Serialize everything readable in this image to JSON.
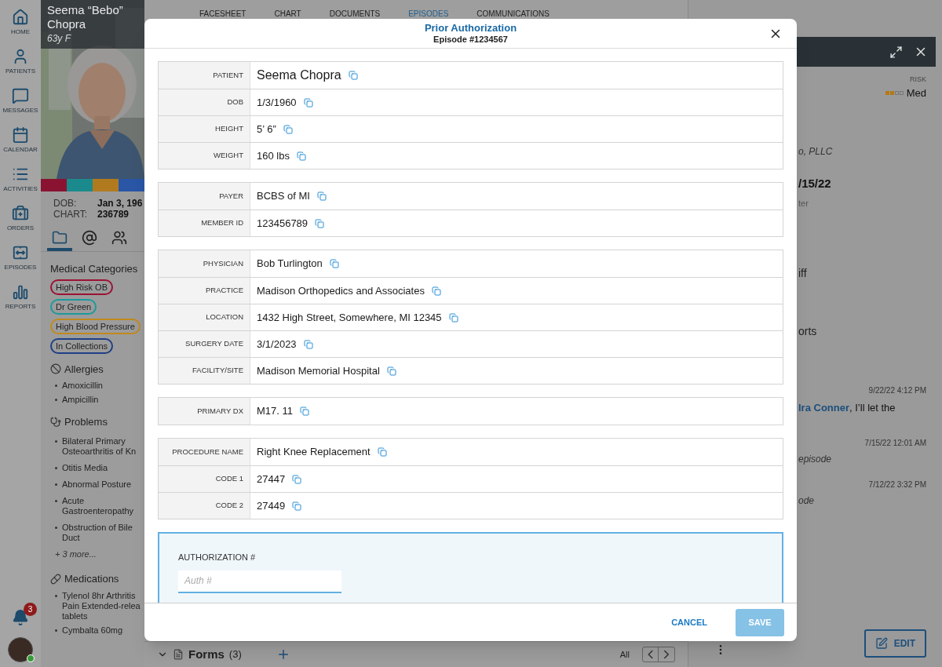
{
  "nav": [
    {
      "kind": "home",
      "label": "HOME"
    },
    {
      "kind": "patients",
      "label": "PATIENTS"
    },
    {
      "kind": "messages",
      "label": "MESSAGES"
    },
    {
      "kind": "calendar",
      "label": "CALENDAR"
    },
    {
      "kind": "activities",
      "label": "ACTIVITIES"
    },
    {
      "kind": "orders",
      "label": "ORDERS"
    },
    {
      "kind": "episodes",
      "label": "EPISODES"
    },
    {
      "kind": "reports",
      "label": "REPORTS"
    }
  ],
  "notifications": {
    "count": "3"
  },
  "user": {
    "online": true
  },
  "patient": {
    "name": "Seema “Bebo” Chopra",
    "age_sex": "63y F",
    "color_bar": [
      {
        "color": "#8a1331"
      },
      {
        "color": "#1b8a8c"
      },
      {
        "color": "#b27a1f"
      },
      {
        "color": "#2a56a6"
      }
    ],
    "fields": [
      {
        "label": "DOB:",
        "value": "Jan 3, 196"
      },
      {
        "label": "CHART:",
        "value": "236789"
      }
    ],
    "tabs": [
      {
        "kind": "folder",
        "selected": true
      },
      {
        "kind": "mention",
        "selected": false
      },
      {
        "kind": "people",
        "selected": false
      }
    ],
    "medical_categories": {
      "title": "Medical Categories",
      "tags": [
        {
          "label": "High Risk OB",
          "color": "#9c1233"
        },
        {
          "label": "Dr Green",
          "color": "#1b9a9c"
        },
        {
          "label": "High Blood Pressure",
          "color": "#c08a1c"
        },
        {
          "label": "In Collections",
          "color": "#1f3f86"
        }
      ]
    },
    "allergies": {
      "title": "Allergies",
      "items": [
        "Amoxicillin",
        "Ampicillin"
      ]
    },
    "problems": {
      "title": "Problems",
      "items": [
        "Bilateral Primary\nOsteoarthritis of Kn",
        "Otitis Media",
        "Abnormal Posture",
        "Acute\nGastroenteropathy",
        "Obstruction of Bile\nDuct"
      ],
      "more": "+ 3 more..."
    },
    "medications": {
      "title": "Medications",
      "items": [
        "Tylenol 8hr Arthritis\nPain Extended-relea\ntablets",
        "Cymbalta 60mg"
      ]
    }
  },
  "main_tabs": [
    {
      "label": "FACESHEET",
      "selected": false
    },
    {
      "label": "CHART",
      "selected": false
    },
    {
      "label": "DOCUMENTS",
      "selected": false
    },
    {
      "label": "EPISODES",
      "selected": true
    },
    {
      "label": "COMMUNICATIONS",
      "selected": false
    }
  ],
  "forms_bar": {
    "title": "Forms",
    "count": "(3)",
    "filter": "All"
  },
  "right_panel": {
    "risk": {
      "label": "RISK",
      "value": "Med",
      "level": 0.5
    },
    "fragments": [
      {
        "kind": "italic",
        "text": "o, PLLC"
      },
      {
        "kind": "bold",
        "text": "/15/22"
      },
      {
        "kind": "muted",
        "text": "ter"
      },
      {
        "kind": "plain",
        "text": "iff"
      },
      {
        "kind": "plain",
        "text": "orts"
      },
      {
        "kind": "time",
        "text": "9/22/22 4:12 PM"
      },
      {
        "kind": "mention",
        "link": "lra Conner",
        "text": ", I’ll let the"
      },
      {
        "kind": "time",
        "text": "7/15/22 12:01 AM"
      },
      {
        "kind": "italic",
        "text": "episode"
      },
      {
        "kind": "time",
        "text": "7/12/22 3:32 PM"
      },
      {
        "kind": "italic",
        "text": "ode"
      }
    ],
    "edit_button": "EDIT"
  },
  "modal": {
    "title": "Prior Authorization",
    "subtitle": "Episode #1234567",
    "groups": [
      [
        {
          "label": "PATIENT",
          "value": "Seema Chopra"
        },
        {
          "label": "DOB",
          "value": "1/3/1960"
        },
        {
          "label": "HEIGHT",
          "value": "5’ 6”"
        },
        {
          "label": "WEIGHT",
          "value": "160 lbs"
        }
      ],
      [
        {
          "label": "PAYER",
          "value": "BCBS of MI"
        },
        {
          "label": "MEMBER ID",
          "value": "123456789"
        }
      ],
      [
        {
          "label": "PHYSICIAN",
          "value": "Bob Turlington"
        },
        {
          "label": "PRACTICE",
          "value": "Madison Orthopedics and Associates"
        },
        {
          "label": "LOCATION",
          "value": "1432 High Street, Somewhere, MI 12345"
        },
        {
          "label": "SURGERY DATE",
          "value": "3/1/2023"
        },
        {
          "label": "FACILITY/SITE",
          "value": "Madison Memorial Hospital"
        }
      ],
      [
        {
          "label": "PRIMARY DX",
          "value": "M17. 11"
        }
      ],
      [
        {
          "label": "PROCEDURE NAME",
          "value": "Right Knee Replacement"
        },
        {
          "label": "CODE 1",
          "value": "27447"
        },
        {
          "label": "CODE 2",
          "value": "27449"
        }
      ]
    ],
    "authorization": {
      "label": "AUTHORIZATION #",
      "placeholder": "Auth #"
    },
    "cancel": {
      "label": "CANCEL"
    },
    "save": {
      "label": "SAVE",
      "disabled": true
    }
  }
}
